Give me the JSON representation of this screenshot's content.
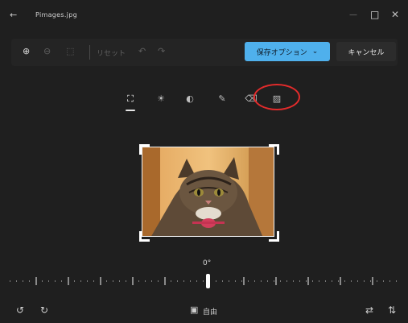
{
  "window": {
    "title": "Pimages.jpg",
    "back_glyph": "←",
    "minimize_glyph": "—",
    "maximize_glyph": "□",
    "close_glyph": "✕"
  },
  "toolbar": {
    "zoom_in": "⊕",
    "zoom_out": "⊖",
    "fit": "⬚",
    "reset_label": "リセット",
    "undo": "↶",
    "redo": "↷",
    "save_label": "保存オプション",
    "save_chevron": "⌄",
    "cancel_label": "キャンセル"
  },
  "tabs": [
    {
      "name": "crop",
      "glyph": "⛶"
    },
    {
      "name": "adjust",
      "glyph": "☀"
    },
    {
      "name": "filter",
      "glyph": "◐"
    },
    {
      "name": "markup",
      "glyph": "✎"
    },
    {
      "name": "erase",
      "glyph": "⌫"
    },
    {
      "name": "background",
      "glyph": "▨"
    }
  ],
  "rotation": {
    "label": "0°",
    "value_degrees": 0
  },
  "bottom": {
    "rotate_left": "↺",
    "rotate_right": "↻",
    "aspect_icon": "▣",
    "aspect_label": "自由",
    "flip_horizontal": "⇄",
    "flip_vertical": "⇅"
  },
  "colors": {
    "background": "#1f1f1f",
    "accent": "#4fb0ec",
    "highlight": "#e22b2b"
  }
}
